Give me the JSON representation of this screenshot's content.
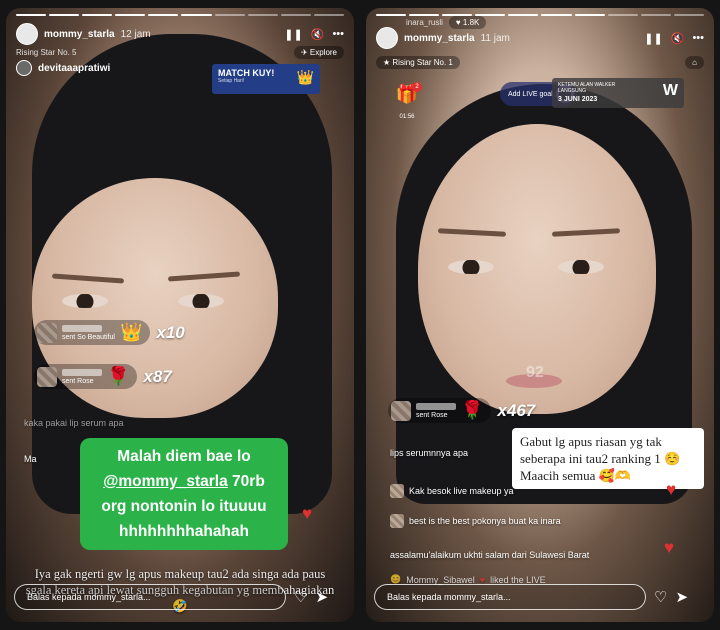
{
  "left": {
    "username": "mommy_starla",
    "time": "12 jam",
    "live_tag": "Rising Star No. 5",
    "host": "devitaaapratiwi",
    "explore_label": "Explore",
    "match_title": "MATCH KUY!",
    "match_sub": "Setiap Hari!",
    "gifts": [
      {
        "text": "sent So Beautiful",
        "icon": "crown-gift-icon",
        "count": "x10"
      },
      {
        "text": "sent Rose",
        "icon": "rose-icon",
        "count": "x87"
      }
    ],
    "comment_faded": "kaka pakai lip serum apa",
    "comment_prefix": "Ma",
    "green_text": [
      "Malah diem bae lo",
      "@mommy_starla",
      "70rb",
      "org nontonin lo ituuuu",
      "hhhhhhhhahahah"
    ],
    "caption": "Iya gak ngerti gw lg apus makeup tau2 ada singa ada paus sgala kereta api lewat sungguh kegabutan yg membahagiakan 🤣",
    "reply_placeholder": "Balas kepada mommy_starla..."
  },
  "right": {
    "username": "mommy_starla",
    "time": "11 jam",
    "viewer_name": "inara_rusli",
    "likes": "1.8K",
    "live_tag": "Rising Star No. 1",
    "gift_box_time": "01:56",
    "gift_box_badge": "2",
    "live_goal": "Add LIVE goal",
    "alan_line1": "KETEMU ALAN WALKER",
    "alan_line2": "LANGSUNG",
    "alan_date": "3 JUNI 2023",
    "alan_logo": "W",
    "faded_count": "92",
    "gift": {
      "text": "sent Rose",
      "icon": "rose-icon",
      "count": "x467"
    },
    "caption_card": "Gabut lg apus riasan yg tak seberapa ini tau2 ranking 1 ☺️ Maacih semua 🥰🫶",
    "comments": [
      "lips serumnnya apa",
      "Kak besok live makeup ya",
      "best is the best pokonya buat ka inara",
      "assalamu'alaikum ukhti salam dari Sulawesi Barat"
    ],
    "join_text": "Mommy_Sibawel",
    "join_suffix": "liked the LIVE",
    "reply_placeholder": "Balas kepada mommy_starla..."
  }
}
